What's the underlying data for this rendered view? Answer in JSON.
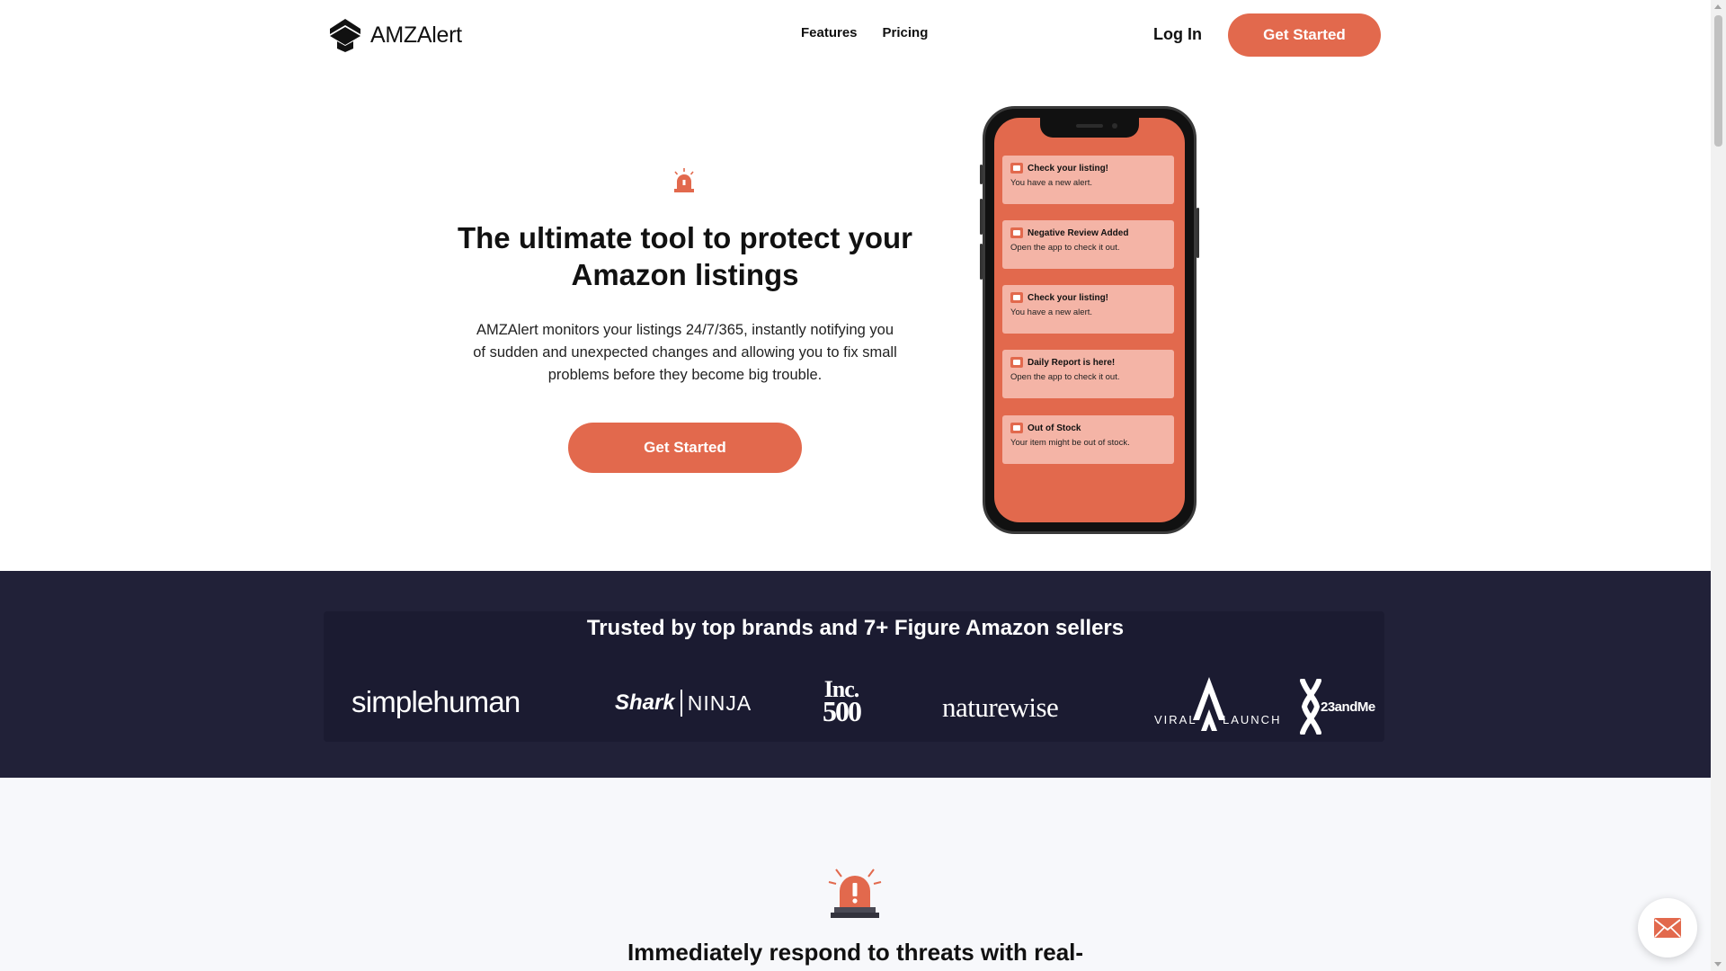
{
  "header": {
    "logo_text": "AMZAlert",
    "nav": [
      {
        "label": "Features"
      },
      {
        "label": "Pricing"
      }
    ],
    "login_label": "Log In",
    "cta_label": "Get Started"
  },
  "hero": {
    "title": "The ultimate tool to protect your Amazon listings",
    "subtitle": "AMZAlert monitors your listings 24/7/365, instantly notifying you of sudden and unexpected changes and allowing you to fix small problems before they become big trouble.",
    "cta_label": "Get Started",
    "icon": "alarm-siren-icon"
  },
  "phone": {
    "notifications": [
      {
        "title": "Check your listing!",
        "body": "You have a new alert."
      },
      {
        "title": "Negative Review Added",
        "body": "Open the app to check it out."
      },
      {
        "title": "Check your listing!",
        "body": "You have a new alert."
      },
      {
        "title": "Daily Report is here!",
        "body": "Open the app to check it out."
      },
      {
        "title": "Out of Stock",
        "body": "Your item might be out of stock."
      }
    ]
  },
  "brands": {
    "title": "Trusted by top brands and 7+ Figure Amazon sellers",
    "simplehuman": "simplehuman",
    "shark": "Shark",
    "ninja": "NINJA",
    "inc_line1": "Inc.",
    "inc_line2": "500",
    "naturewise": "naturewise",
    "viral_left": "VIRAL",
    "viral_right": "LAUNCH",
    "twentythree": "23andMe"
  },
  "lower": {
    "title": "Immediately respond to threats with real-",
    "icon": "alarm-siren-icon"
  },
  "colors": {
    "accent": "#e2694d",
    "band": "#212138",
    "notification": "#f4b4a6",
    "section_bg": "#f7f8fb"
  },
  "chat": {
    "icon": "envelope-icon"
  }
}
